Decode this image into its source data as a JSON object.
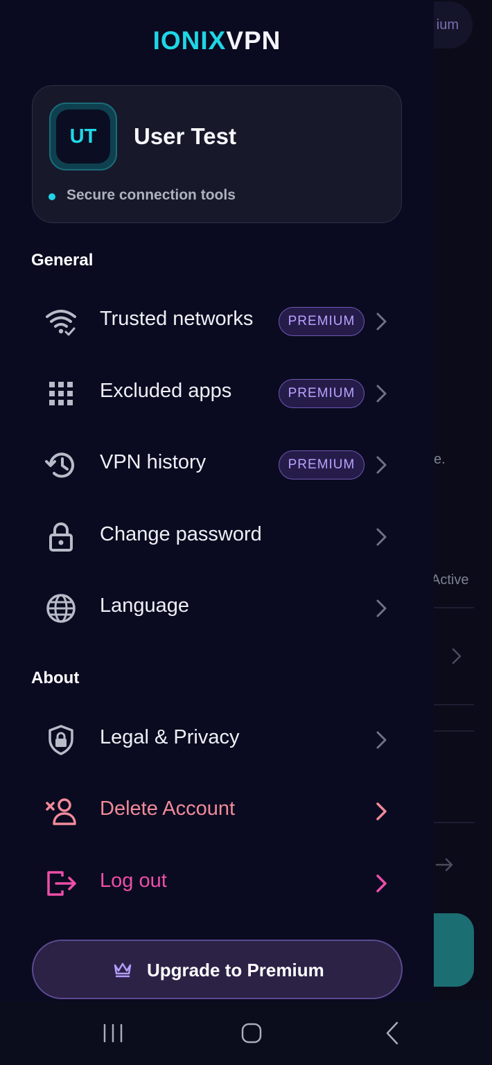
{
  "background": {
    "pill_text": "ium",
    "text_1": "e.",
    "text_2": "Active"
  },
  "logo": {
    "part1": "IONIX",
    "part2": "VPN"
  },
  "profile": {
    "initials": "UT",
    "name": "User Test",
    "status": "Secure connection tools"
  },
  "sections": {
    "general": "General",
    "about": "About"
  },
  "menu": {
    "trusted_networks": {
      "label": "Trusted networks",
      "badge": "PREMIUM",
      "icon": "wifi-check-icon"
    },
    "excluded_apps": {
      "label": "Excluded apps",
      "badge": "PREMIUM",
      "icon": "apps-grid-icon"
    },
    "vpn_history": {
      "label": "VPN history",
      "badge": "PREMIUM",
      "icon": "history-icon"
    },
    "change_password": {
      "label": "Change password",
      "icon": "lock-icon"
    },
    "language": {
      "label": "Language",
      "icon": "globe-icon"
    },
    "legal_privacy": {
      "label": "Legal & Privacy",
      "icon": "shield-lock-icon"
    },
    "delete_account": {
      "label": "Delete Account",
      "icon": "remove-user-icon"
    },
    "log_out": {
      "label": "Log out",
      "icon": "logout-icon"
    }
  },
  "upgrade": {
    "label": "Upgrade to Premium",
    "icon": "crown-icon"
  },
  "colors": {
    "accent_cyan": "#1fd6e6",
    "premium_purple": "#b9a2ff",
    "danger": "#f28a9a",
    "logout": "#ee4ea8"
  }
}
